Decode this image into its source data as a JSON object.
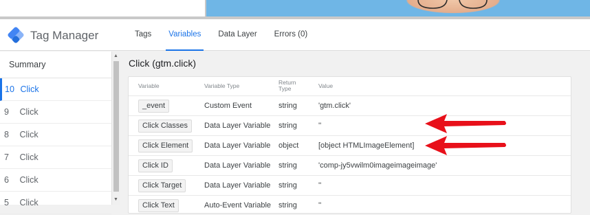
{
  "header": {
    "app_title": "Tag Manager",
    "tabs": [
      {
        "label": "Tags",
        "active": false
      },
      {
        "label": "Variables",
        "active": true
      },
      {
        "label": "Data Layer",
        "active": false
      },
      {
        "label": "Errors (0)",
        "active": false
      }
    ]
  },
  "sidebar": {
    "summary": "Summary",
    "events": [
      {
        "num": "10",
        "label": "Click",
        "active": true
      },
      {
        "num": "9",
        "label": "Click",
        "active": false
      },
      {
        "num": "8",
        "label": "Click",
        "active": false
      },
      {
        "num": "7",
        "label": "Click",
        "active": false
      },
      {
        "num": "6",
        "label": "Click",
        "active": false
      },
      {
        "num": "5",
        "label": "Click",
        "active": false
      }
    ]
  },
  "main": {
    "title": "Click (gtm.click)",
    "columns": {
      "variable": "Variable",
      "type": "Variable Type",
      "return_type_1": "Return",
      "return_type_2": "Type",
      "value": "Value"
    },
    "rows": [
      {
        "name": "_event",
        "type": "Custom Event",
        "return_type": "string",
        "value": "'gtm.click'"
      },
      {
        "name": "Click Classes",
        "type": "Data Layer Variable",
        "return_type": "string",
        "value": "''"
      },
      {
        "name": "Click Element",
        "type": "Data Layer Variable",
        "return_type": "object",
        "value": "[object HTMLImageElement]"
      },
      {
        "name": "Click ID",
        "type": "Data Layer Variable",
        "return_type": "string",
        "value": "'comp-jy5vwilm0imageimageimage'"
      },
      {
        "name": "Click Target",
        "type": "Data Layer Variable",
        "return_type": "string",
        "value": "''"
      },
      {
        "name": "Click Text",
        "type": "Auto-Event Variable",
        "return_type": "string",
        "value": "''"
      }
    ]
  },
  "colors": {
    "accent": "#1a73e8",
    "annotation_arrow": "#e8101a"
  }
}
